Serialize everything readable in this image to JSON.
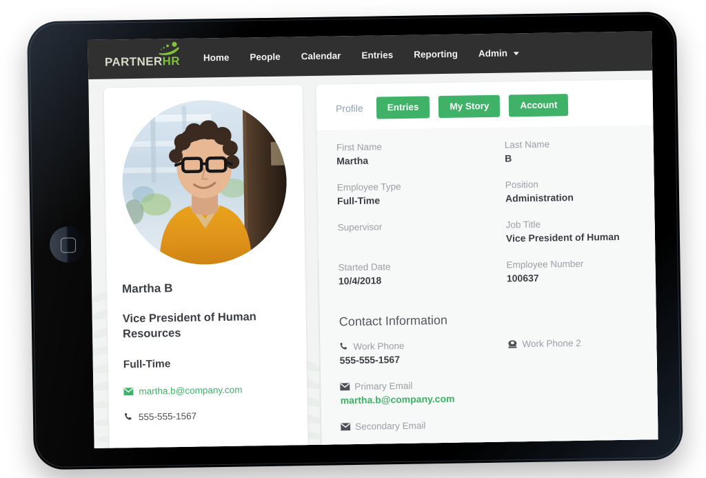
{
  "brand": {
    "logo_partner": "PARTNER",
    "logo_hr": "HR",
    "green": "#3fb268",
    "nav_bg": "#303030",
    "logo_green": "#7ec13a"
  },
  "nav": {
    "items": [
      {
        "label": "Home",
        "name": "home",
        "caret": false
      },
      {
        "label": "People",
        "name": "people",
        "caret": false
      },
      {
        "label": "Calendar",
        "name": "calendar",
        "caret": false
      },
      {
        "label": "Entries",
        "name": "entries",
        "caret": false
      },
      {
        "label": "Reporting",
        "name": "reporting",
        "caret": false
      },
      {
        "label": "Admin",
        "name": "admin",
        "caret": true
      }
    ]
  },
  "profile_card": {
    "avatar_alt": "employee-photo",
    "name": "Martha B",
    "job_title": "Vice President of Human Resources",
    "employee_type": "Full-Time",
    "email": "martha.b@company.com",
    "email_icon": "envelope-icon",
    "phone": "555-555-1567",
    "phone_icon": "phone-icon"
  },
  "tabs": {
    "profile_link": "Profile",
    "buttons": [
      {
        "label": "Entries",
        "name": "entries"
      },
      {
        "label": "My Story",
        "name": "my-story"
      },
      {
        "label": "Account",
        "name": "account"
      }
    ]
  },
  "details": {
    "fields": [
      {
        "label": "First Name",
        "value": "Martha",
        "name": "first-name"
      },
      {
        "label": "Last Name",
        "value": "B",
        "name": "last-name"
      },
      {
        "label": "Employee Type",
        "value": "Full-Time",
        "name": "employee-type"
      },
      {
        "label": "Position",
        "value": "Administration",
        "name": "position"
      },
      {
        "label": "Supervisor",
        "value": "",
        "name": "supervisor"
      },
      {
        "label": "Job Title",
        "value": "Vice President of Human",
        "name": "job-title"
      },
      {
        "label": "Started Date",
        "value": "10/4/2018",
        "name": "started-date"
      },
      {
        "label": "Employee Number",
        "value": "100637",
        "name": "employee-number"
      }
    ]
  },
  "contact": {
    "heading": "Contact Information",
    "fields": [
      {
        "label": "Work Phone",
        "value": "555-555-1567",
        "icon": "phone-icon",
        "green": false,
        "name": "work-phone"
      },
      {
        "label": "Work Phone 2",
        "value": "",
        "icon": "telephone-icon",
        "green": false,
        "name": "work-phone-2"
      },
      {
        "label": "Primary Email",
        "value": "martha.b@company.com",
        "icon": "envelope-icon",
        "green": true,
        "name": "primary-email"
      },
      {
        "label": "Secondary Email",
        "value": "",
        "icon": "envelope-icon",
        "green": false,
        "name": "secondary-email"
      }
    ]
  }
}
